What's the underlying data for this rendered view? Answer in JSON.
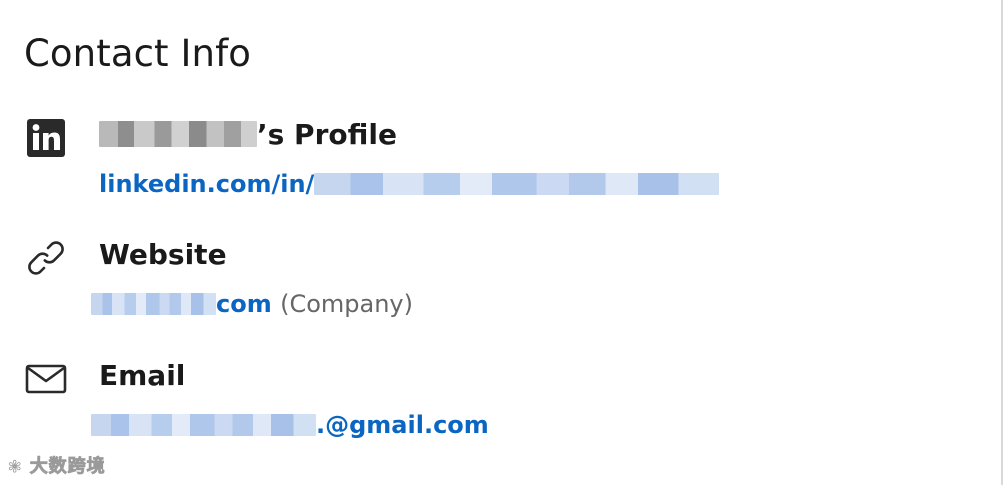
{
  "card": {
    "title": "Contact Info"
  },
  "profile": {
    "icon": "linkedin-icon",
    "heading_suffix": "’s Profile",
    "link_prefix": "linkedin.com/in/"
  },
  "website": {
    "icon": "link-icon",
    "heading": "Website",
    "link_suffix": "com",
    "link_note": "(Company)"
  },
  "email": {
    "icon": "envelope-icon",
    "heading": "Email",
    "link_suffix": ".@gmail.com"
  },
  "watermark": {
    "text": "大数跨境"
  },
  "colors": {
    "link": "#0a66c2",
    "text": "#1a1a1a",
    "muted": "#666666"
  }
}
